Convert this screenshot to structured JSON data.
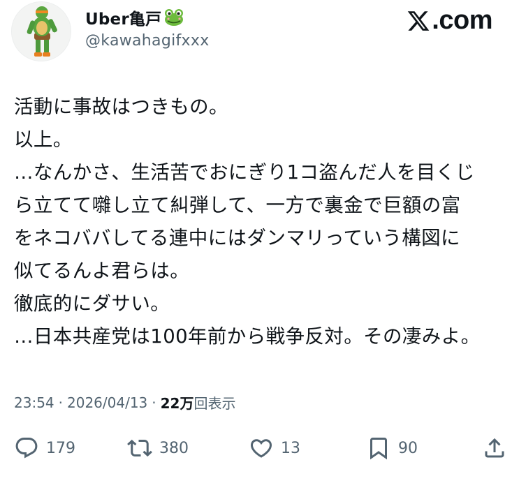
{
  "author": {
    "display_name": "Uber亀戸",
    "handle": "@kawahagifxxx",
    "name_emoji": "frog-icon"
  },
  "brand": {
    "label": ".com",
    "logo_icon": "x-logo-icon"
  },
  "tweet": {
    "lines": [
      "活動に事故はつきもの。",
      "以上。",
      "…なんかさ、生活苦でおにぎり1コ盗んだ人を目くじ",
      "ら立てて囃し立て糾弾して、一方で裏金で巨額の富",
      "をネコババしてる連中にはダンマリっていう構図に",
      "似てるんよ君らは。",
      "徹底的にダサい。",
      "…日本共産党は100年前から戦争反対。その凄みよ。"
    ]
  },
  "meta": {
    "time": "23:54",
    "separator": "·",
    "date": "2026/04/13",
    "views_count": "22万",
    "views_label": "回表示"
  },
  "actions": {
    "reply_count": "179",
    "repost_count": "380",
    "like_count": "13",
    "bookmark_count": "90"
  },
  "colors": {
    "text_primary": "#0f1419",
    "text_secondary": "#536471",
    "background": "#ffffff"
  }
}
